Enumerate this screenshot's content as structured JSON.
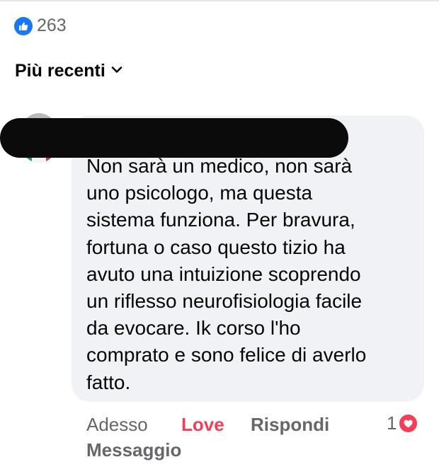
{
  "reactions": {
    "icon": "like-icon",
    "count": "263",
    "accent": "#1877f2"
  },
  "sort": {
    "label": "Più recenti",
    "icon": "chevron-down-icon"
  },
  "comment": {
    "author_redacted": true,
    "lines": [
      "Non sarà un medico, non sarà",
      "uno psicologo, ma questa",
      "sistema funziona. Per bravura,",
      "fortuna o caso questo tizio ha",
      "avuto una intuizione scoprendo",
      "un riflesso neurofisiologia facile",
      "da evocare. Ik corso l'ho",
      "comprato e sono felice di averlo",
      "fatto."
    ],
    "bubble_color": "#f0f2f5"
  },
  "actions": {
    "time": "Adesso",
    "love": "Love",
    "reply": "Rispondi",
    "message": "Messaggio",
    "love_color": "#f33e58"
  },
  "comment_reactions": {
    "count": "1",
    "icon": "heart-icon"
  }
}
